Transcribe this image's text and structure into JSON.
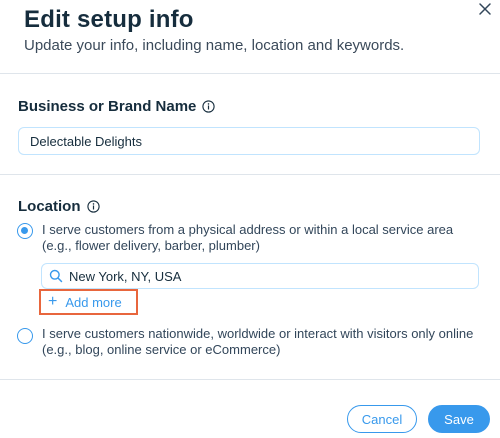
{
  "dialog": {
    "title": "Edit setup info",
    "subtitle": "Update your info, including name, location and keywords."
  },
  "business": {
    "label": "Business or Brand Name",
    "value": "Delectable Delights"
  },
  "location": {
    "label": "Location",
    "option_local": "I serve customers from a physical address or within a local service area (e.g., flower delivery, barber, plumber)",
    "address_value": "New York, NY, USA",
    "add_more_label": "Add more",
    "option_online": "I serve customers nationwide, worldwide or interact with visitors only online (e.g., blog, online service or eCommerce)"
  },
  "footer": {
    "cancel_label": "Cancel",
    "save_label": "Save"
  },
  "colors": {
    "accent": "#3899ec",
    "highlight_border": "#e8663d",
    "text_dark": "#162d3d"
  },
  "icons": [
    "close-icon",
    "info-icon",
    "search-icon",
    "plus-icon"
  ]
}
